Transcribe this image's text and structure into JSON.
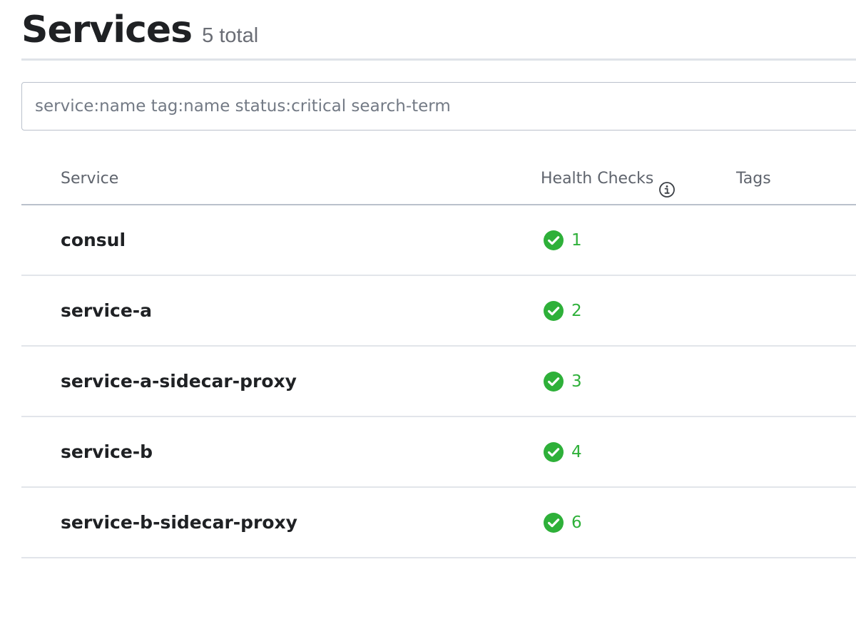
{
  "header": {
    "title": "Services",
    "count_label": "5 total"
  },
  "search": {
    "placeholder": "service:name tag:name status:critical search-term",
    "value": ""
  },
  "table": {
    "columns": {
      "service": "Service",
      "health_checks": "Health Checks",
      "tags": "Tags"
    },
    "header_icon": "info-icon",
    "rows": [
      {
        "name": "consul",
        "passing": "1",
        "status_icon": "check-circle-icon",
        "tags": ""
      },
      {
        "name": "service-a",
        "passing": "2",
        "status_icon": "check-circle-icon",
        "tags": ""
      },
      {
        "name": "service-a-sidecar-proxy",
        "passing": "3",
        "status_icon": "check-circle-icon",
        "tags": ""
      },
      {
        "name": "service-b",
        "passing": "4",
        "status_icon": "check-circle-icon",
        "tags": ""
      },
      {
        "name": "service-b-sidecar-proxy",
        "passing": "6",
        "status_icon": "check-circle-icon",
        "tags": ""
      }
    ]
  },
  "colors": {
    "passing": "#2eb039",
    "text": "#1f2124",
    "muted": "#6a6d75",
    "border": "#bac1cc",
    "row_divider": "#e2e5ea"
  }
}
